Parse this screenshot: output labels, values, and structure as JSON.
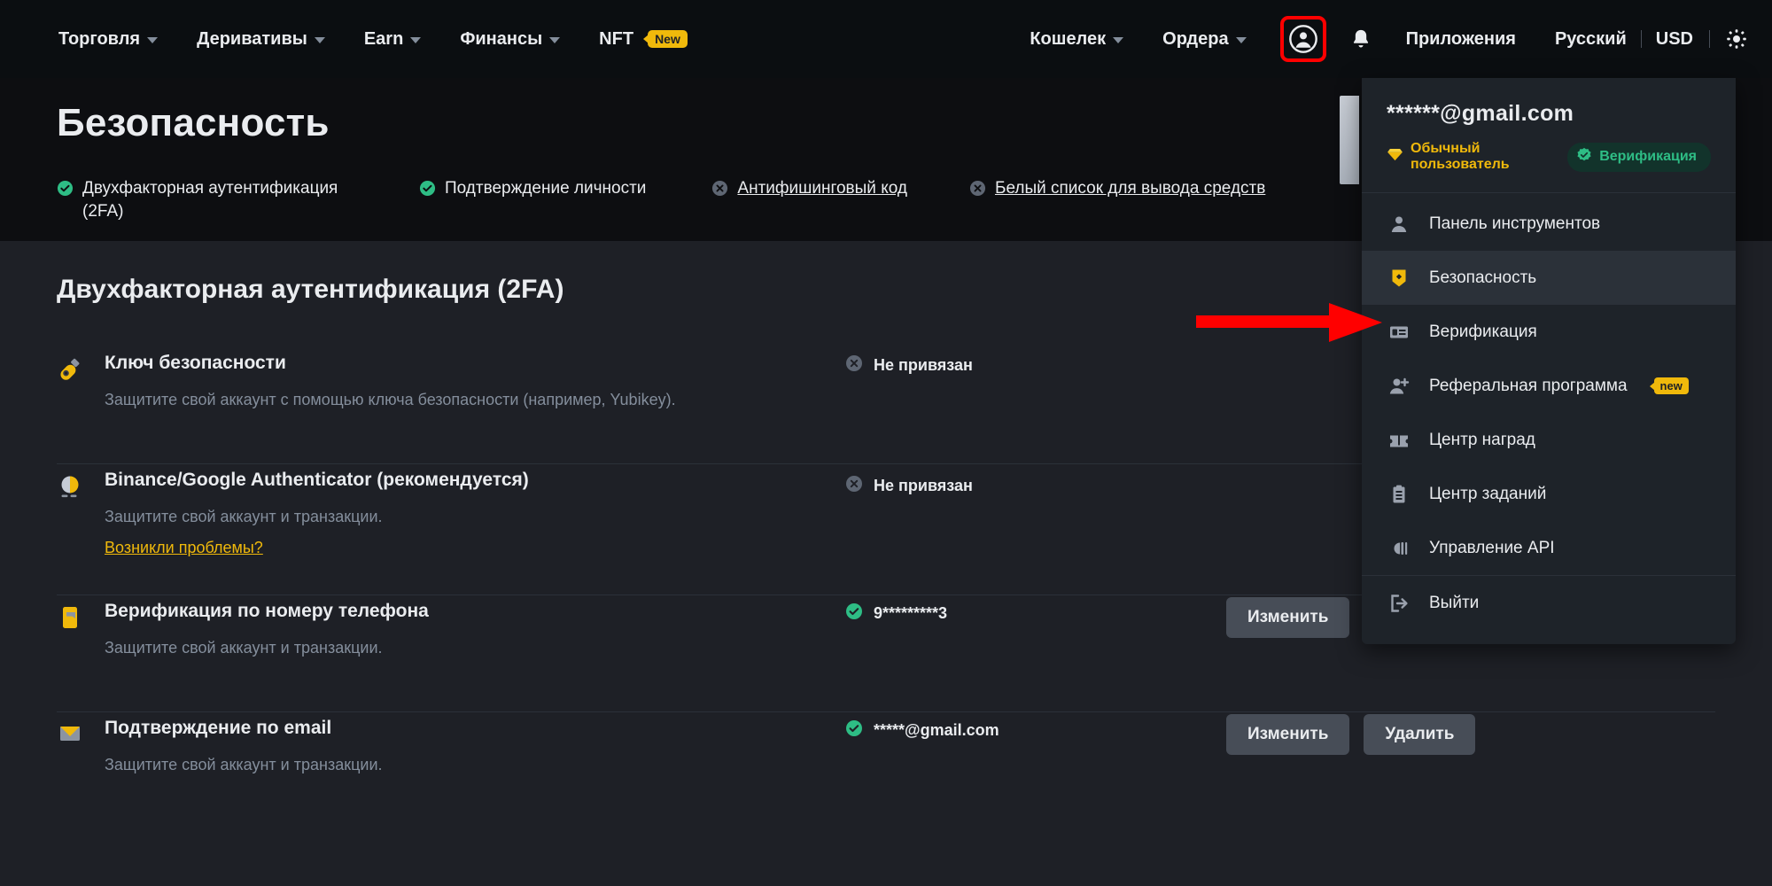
{
  "navbar": {
    "left_items": [
      {
        "label": "Торговля",
        "caret": true,
        "badge": null
      },
      {
        "label": "Деривативы",
        "caret": true,
        "badge": null
      },
      {
        "label": "Earn",
        "caret": true,
        "badge": null
      },
      {
        "label": "Финансы",
        "caret": true,
        "badge": null
      },
      {
        "label": "NFT",
        "caret": false,
        "badge": "New"
      }
    ],
    "right_items": [
      {
        "label": "Кошелек",
        "caret": true
      },
      {
        "label": "Ордера",
        "caret": true
      }
    ],
    "apps_label": "Приложения",
    "language_label": "Русский",
    "currency_label": "USD",
    "profile_icon": "user-circle-icon",
    "bell_icon": "notification-bell-icon",
    "theme_icon": "sun-theme-icon",
    "highlight_color": "#ff0000"
  },
  "hero": {
    "title": "Безопасность",
    "tabs": [
      {
        "label": "Двухфакторная аутентификация (2FA)",
        "status": "ok",
        "link": false
      },
      {
        "label": "Подтверждение личности",
        "status": "ok",
        "link": false
      },
      {
        "label": "Антифишинговый код",
        "status": "off",
        "link": true
      },
      {
        "label": "Белый список для вывода средств",
        "status": "off",
        "link": true
      }
    ]
  },
  "main": {
    "section_title": "Двухфакторная аутентификация (2FA)",
    "rows": [
      {
        "icon": "security-key-icon",
        "name": "Ключ безопасности",
        "desc": "Защитите свой аккаунт с помощью ключа безопасности (например, Yubikey).",
        "link": null,
        "status_text": "Не привязан",
        "status": "off",
        "actions": []
      },
      {
        "icon": "authenticator-app-icon",
        "name": "Binance/Google Authenticator (рекомендуется)",
        "desc": "Защитите свой аккаунт и транзакции.",
        "link": "Возникли проблемы?",
        "status_text": "Не привязан",
        "status": "off",
        "actions": []
      },
      {
        "icon": "phone-icon",
        "name": "Верификация по номеру телефона",
        "desc": "Защитите свой аккаунт и транзакции.",
        "link": null,
        "status_text": "9*********3",
        "status": "ok",
        "actions": [
          "Изменить"
        ]
      },
      {
        "icon": "email-icon",
        "name": "Подтверждение по email",
        "desc": "Защитите свой аккаунт и транзакции.",
        "link": null,
        "status_text": "*****@gmail.com",
        "status": "ok",
        "actions": [
          "Изменить",
          "Удалить"
        ]
      }
    ]
  },
  "dropdown": {
    "email": "******@gmail.com",
    "user_level": "Обычный пользователь",
    "verification_badge": "Верификация",
    "items": [
      {
        "icon": "person-icon",
        "label": "Панель инструментов",
        "active": false,
        "badge": null
      },
      {
        "icon": "shield-icon",
        "label": "Безопасность",
        "active": true,
        "badge": null
      },
      {
        "icon": "id-card-icon",
        "label": "Верификация",
        "active": false,
        "badge": null
      },
      {
        "icon": "person-add-icon",
        "label": "Реферальная программа",
        "active": false,
        "badge": "new"
      },
      {
        "icon": "ticket-icon",
        "label": "Центр наград",
        "active": false,
        "badge": null
      },
      {
        "icon": "clipboard-icon",
        "label": "Центр заданий",
        "active": false,
        "badge": null
      },
      {
        "icon": "api-plug-icon",
        "label": "Управление API",
        "active": false,
        "badge": null
      },
      {
        "icon": "logout-icon",
        "label": "Выйти",
        "active": false,
        "badge": null
      }
    ]
  },
  "annotation": {
    "arrow_color": "#ff0000",
    "arrow_direction": "right"
  },
  "colors": {
    "brand_yellow": "#f0b90b",
    "success_green": "#2ebd85",
    "muted_gray": "#848e9c",
    "nav_bg": "#0b0e11",
    "hero_bg": "#0d0e11",
    "main_bg": "#1e2026",
    "dropdown_bg": "#1e2329",
    "button_bg": "#474d57"
  }
}
